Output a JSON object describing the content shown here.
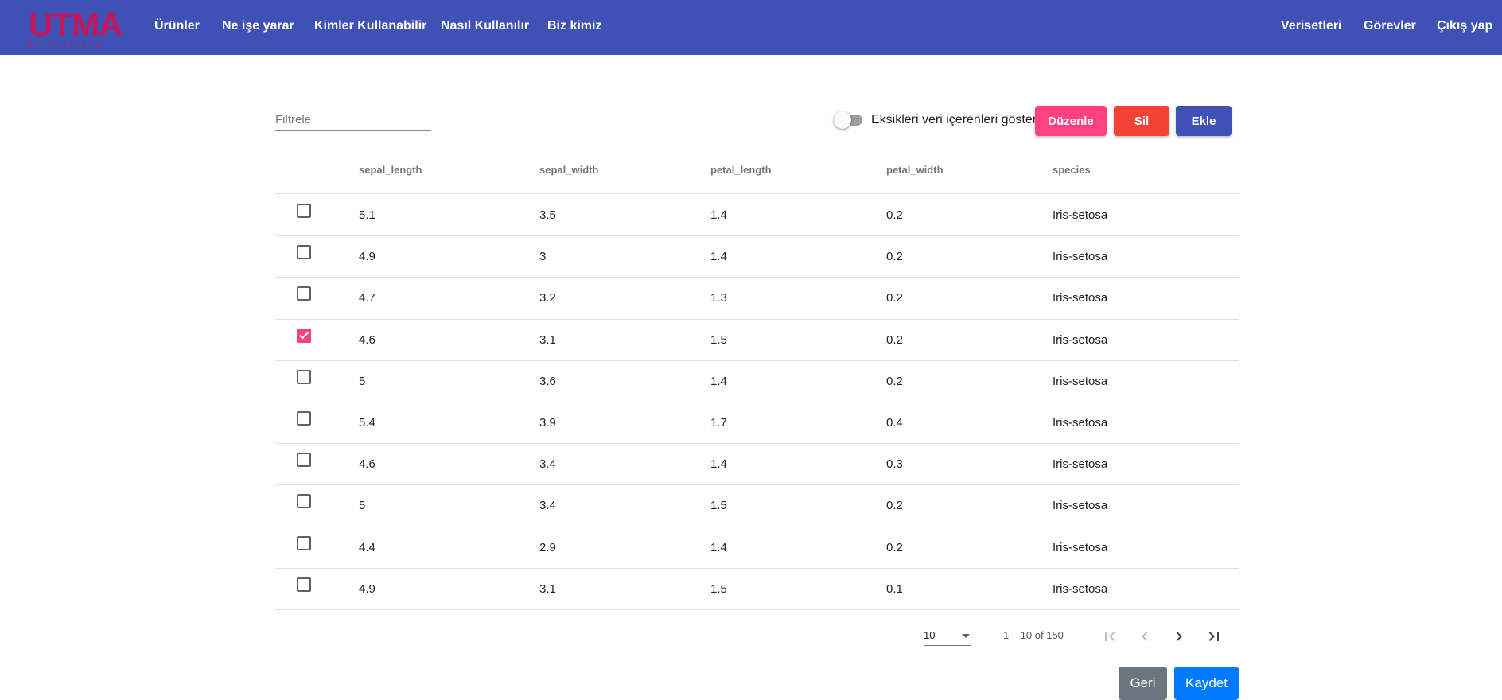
{
  "brand": {
    "logo_text": "UTMA",
    "logo_subtitle": "ML Platform",
    "colors": {
      "header": "#3f51b5",
      "accent": "#ff4081",
      "danger": "#f44336",
      "primary": "#007bff",
      "secondary": "#6c757d"
    }
  },
  "nav": {
    "left": [
      "Ürünler",
      "Ne işe yarar",
      "Kimler Kullanabilir",
      "Nasıl Kullanılır",
      "Biz kimiz"
    ],
    "right": [
      "Verisetleri",
      "Görevler",
      "Çıkış yap"
    ]
  },
  "toolbar": {
    "filter_placeholder": "Filtrele",
    "toggle_label": "Eksikleri veri içerenleri göster",
    "toggle_on": false,
    "edit_label": "Düzenle",
    "delete_label": "Sil",
    "add_label": "Ekle"
  },
  "table": {
    "columns": [
      "sepal_length",
      "sepal_width",
      "petal_length",
      "petal_width",
      "species"
    ],
    "rows": [
      {
        "checked": false,
        "cells": [
          "5.1",
          "3.5",
          "1.4",
          "0.2",
          "Iris-setosa"
        ]
      },
      {
        "checked": false,
        "cells": [
          "4.9",
          "3",
          "1.4",
          "0.2",
          "Iris-setosa"
        ]
      },
      {
        "checked": false,
        "cells": [
          "4.7",
          "3.2",
          "1.3",
          "0.2",
          "Iris-setosa"
        ]
      },
      {
        "checked": true,
        "cells": [
          "4.6",
          "3.1",
          "1.5",
          "0.2",
          "Iris-setosa"
        ]
      },
      {
        "checked": false,
        "cells": [
          "5",
          "3.6",
          "1.4",
          "0.2",
          "Iris-setosa"
        ]
      },
      {
        "checked": false,
        "cells": [
          "5.4",
          "3.9",
          "1.7",
          "0.4",
          "Iris-setosa"
        ]
      },
      {
        "checked": false,
        "cells": [
          "4.6",
          "3.4",
          "1.4",
          "0.3",
          "Iris-setosa"
        ]
      },
      {
        "checked": false,
        "cells": [
          "5",
          "3.4",
          "1.5",
          "0.2",
          "Iris-setosa"
        ]
      },
      {
        "checked": false,
        "cells": [
          "4.4",
          "2.9",
          "1.4",
          "0.2",
          "Iris-setosa"
        ]
      },
      {
        "checked": false,
        "cells": [
          "4.9",
          "3.1",
          "1.5",
          "0.1",
          "Iris-setosa"
        ]
      }
    ]
  },
  "paginator": {
    "page_size": "10",
    "range_label": "1 – 10 of 150"
  },
  "footer": {
    "back_label": "Geri",
    "save_label": "Kaydet"
  }
}
